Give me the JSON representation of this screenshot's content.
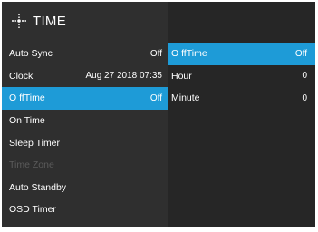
{
  "header": {
    "title": "TIME",
    "icon": "clock-time-icon"
  },
  "left_menu": [
    {
      "label": "Auto Sync",
      "value": "Off",
      "selected": false,
      "disabled": false
    },
    {
      "label": "Clock",
      "value": "Aug 27 2018 07:35",
      "selected": false,
      "disabled": false
    },
    {
      "label": "O ffTime",
      "value": "Off",
      "selected": true,
      "disabled": false
    },
    {
      "label": "On Time",
      "value": "",
      "selected": false,
      "disabled": false
    },
    {
      "label": "Sleep Timer",
      "value": "",
      "selected": false,
      "disabled": false
    },
    {
      "label": "Time Zone",
      "value": "",
      "selected": false,
      "disabled": true
    },
    {
      "label": "Auto Standby",
      "value": "",
      "selected": false,
      "disabled": false
    },
    {
      "label": "OSD Timer",
      "value": "",
      "selected": false,
      "disabled": false
    }
  ],
  "right_menu": [
    {
      "label": "O ffTime",
      "value": "Off",
      "selected": true
    },
    {
      "label": "Hour",
      "value": "0",
      "selected": false
    },
    {
      "label": "Minute",
      "value": "0",
      "selected": false
    }
  ],
  "colors": {
    "highlight": "#1e9bd7",
    "left_panel": "#2f2f2f",
    "right_panel": "#262626",
    "disabled_text": "#5b5b5b"
  }
}
